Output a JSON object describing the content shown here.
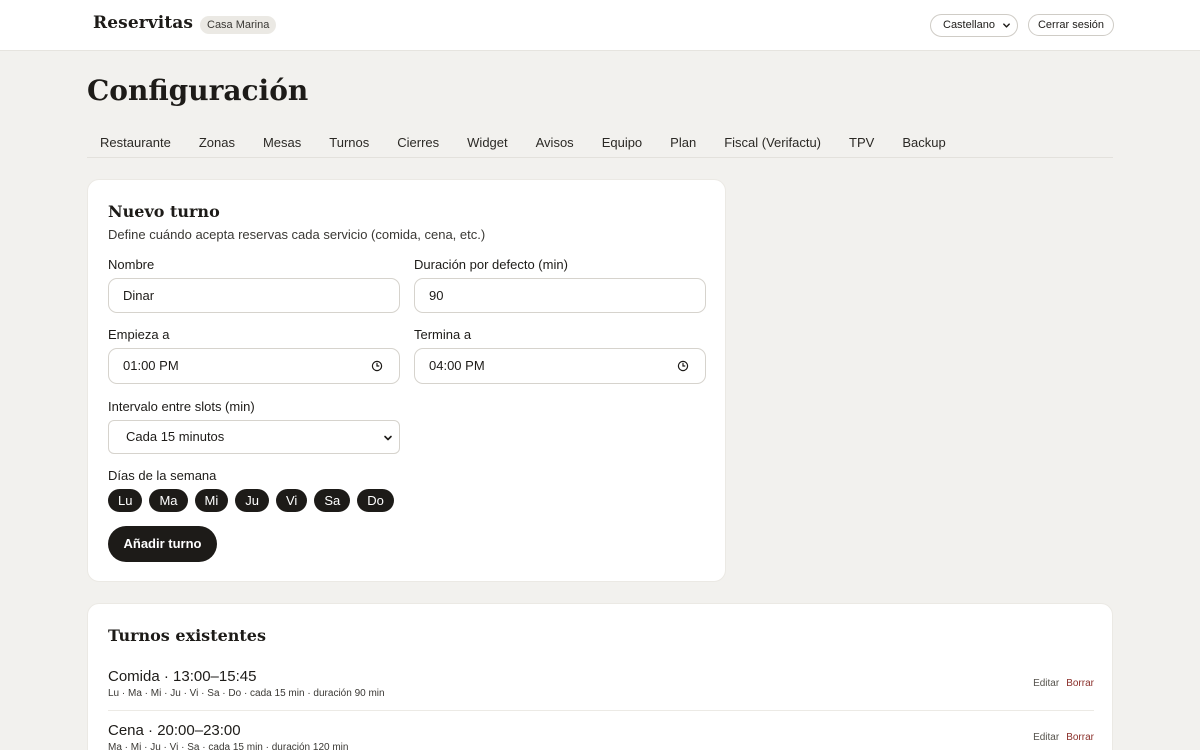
{
  "topbar": {
    "brand": "Reservitas",
    "org_chip": "Casa Marina",
    "language": "Castellano",
    "logout": "Cerrar sesión"
  },
  "page": {
    "title": "Configuración"
  },
  "tabs": [
    {
      "label": "Restaurante"
    },
    {
      "label": "Zonas"
    },
    {
      "label": "Mesas"
    },
    {
      "label": "Turnos"
    },
    {
      "label": "Cierres"
    },
    {
      "label": "Widget"
    },
    {
      "label": "Avisos"
    },
    {
      "label": "Equipo"
    },
    {
      "label": "Plan"
    },
    {
      "label": "Fiscal (Verifactu)"
    },
    {
      "label": "TPV"
    },
    {
      "label": "Backup"
    }
  ],
  "form": {
    "title": "Nuevo turno",
    "subtitle": "Define cuándo acepta reservas cada servicio (comida, cena, etc.)",
    "name_label": "Nombre",
    "name_value": "Dinar",
    "duration_label": "Duración por defecto (min)",
    "duration_value": "90",
    "start_label": "Empieza a",
    "start_value": "01:00 PM",
    "end_label": "Termina a",
    "end_value": "04:00 PM",
    "interval_label": "Intervalo entre slots (min)",
    "interval_value": "Cada 15 minutos",
    "days_label": "Días de la semana",
    "days": [
      "Lu",
      "Ma",
      "Mi",
      "Ju",
      "Vi",
      "Sa",
      "Do"
    ],
    "submit": "Añadir turno"
  },
  "existing": {
    "title": "Turnos existentes",
    "edit_label": "Editar",
    "delete_label": "Borrar",
    "shifts": [
      {
        "title": "Comida · 13:00–15:45",
        "meta": "Lu · Ma · Mi · Ju · Vi · Sa · Do · cada 15 min · duración 90 min"
      },
      {
        "title": "Cena · 20:00–23:00",
        "meta": "Ma · Mi · Ju · Vi · Sa · cada 15 min · duración 120 min"
      }
    ]
  },
  "icons": {
    "brand_chevron": "chevron-down-icon",
    "time": "clock-icon",
    "select_chevron": "chevron-down-icon"
  }
}
